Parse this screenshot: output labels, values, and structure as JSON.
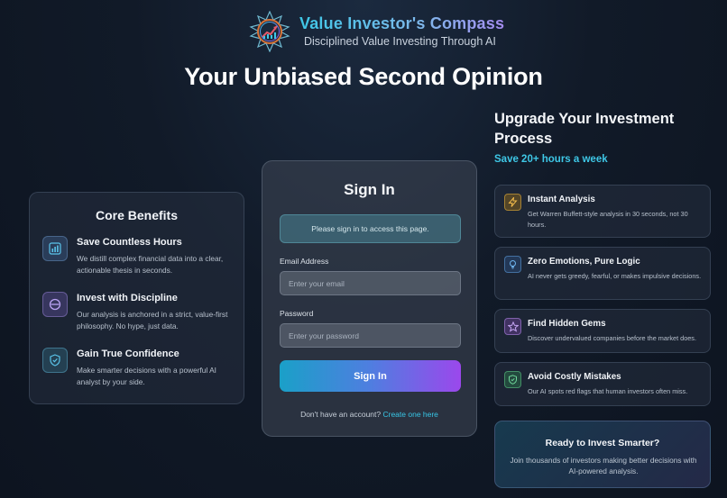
{
  "brand": {
    "title": "Value Investor's Compass",
    "tagline": "Disciplined Value Investing Through AI",
    "logo_icon": "compass-chart-icon"
  },
  "hero": {
    "title": "Your Unbiased Second Opinion"
  },
  "benefits": {
    "title": "Core Benefits",
    "items": [
      {
        "icon": "bar-chart-icon",
        "title": "Save Countless Hours",
        "desc": "We distill complex financial data into a clear, actionable thesis in seconds."
      },
      {
        "icon": "circle-slash-icon",
        "title": "Invest with Discipline",
        "desc": "Our analysis is anchored in a strict, value-first philosophy. No hype, just data."
      },
      {
        "icon": "shield-check-icon",
        "title": "Gain True Confidence",
        "desc": "Make smarter decisions with a powerful AI analyst by your side."
      }
    ]
  },
  "signin": {
    "title": "Sign In",
    "notice": "Please sign in to access this page.",
    "email_label": "Email Address",
    "email_placeholder": "Enter your email",
    "email_value": "",
    "password_label": "Password",
    "password_placeholder": "Enter your password",
    "password_value": "",
    "submit_label": "Sign In",
    "signup_prompt": "Don't have an account?",
    "signup_link": "Create one here"
  },
  "upgrade": {
    "title": "Upgrade Your Investment Process",
    "subtitle": "Save 20+ hours a week",
    "features": [
      {
        "icon": "lightning-icon",
        "title": "Instant Analysis",
        "desc": "Get Warren Buffett-style analysis in 30 seconds, not 30 hours."
      },
      {
        "icon": "lightbulb-icon",
        "title": "Zero Emotions, Pure Logic",
        "desc": "AI never gets greedy, fearful, or makes impulsive decisions."
      },
      {
        "icon": "star-icon",
        "title": "Find Hidden Gems",
        "desc": "Discover undervalued companies before the market does."
      },
      {
        "icon": "shield-check-icon",
        "title": "Avoid Costly Mistakes",
        "desc": "Our AI spots red flags that human investors often miss."
      }
    ]
  },
  "cta": {
    "title": "Ready to Invest Smarter?",
    "desc": "Join thousands of investors making better decisions with AI-powered analysis."
  },
  "colors": {
    "accent_cyan": "#3ec7e6",
    "accent_purple": "#9b48ec",
    "background": "#111a28"
  }
}
